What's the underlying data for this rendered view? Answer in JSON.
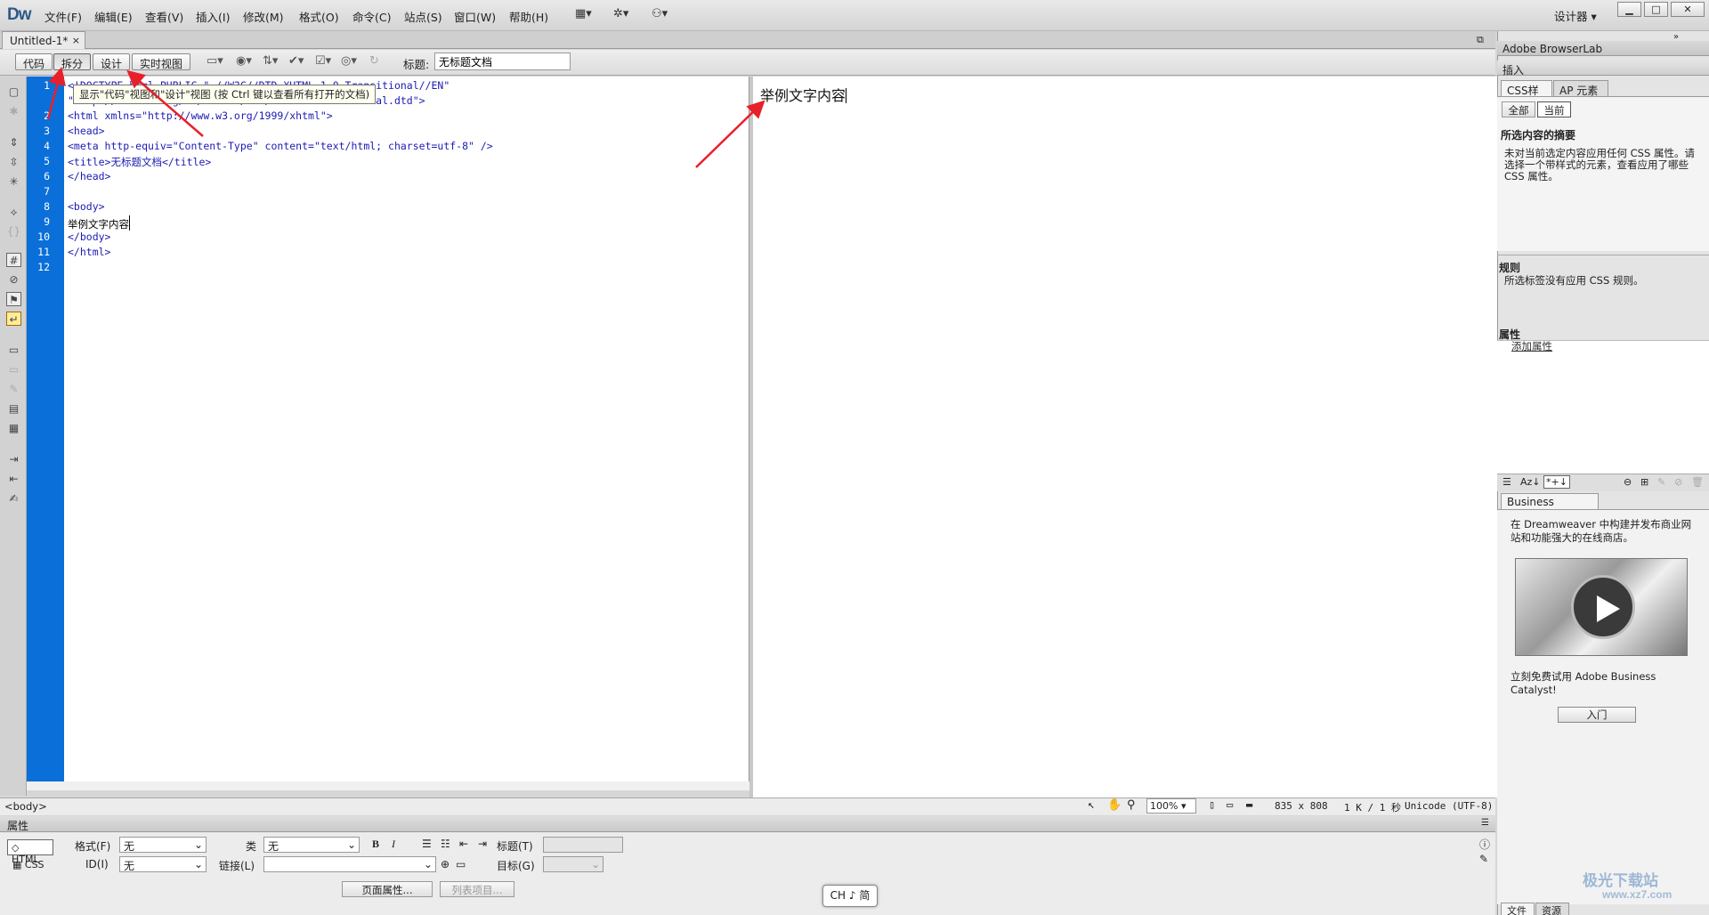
{
  "app": {
    "logo": "Dw"
  },
  "menu": [
    "文件(F)",
    "编辑(E)",
    "查看(V)",
    "插入(I)",
    "修改(M)",
    "格式(O)",
    "命令(C)",
    "站点(S)",
    "窗口(W)",
    "帮助(H)"
  ],
  "workspace": "设计器",
  "tab": {
    "name": "Untitled-1*",
    "close": "×"
  },
  "views": {
    "code": "代码",
    "split": "拆分",
    "design": "设计",
    "live": "实时视图"
  },
  "title_label": "标题:",
  "title_value": "无标题文档",
  "tooltip": "显示\"代码\"视图和\"设计\"视图 (按 Ctrl 键以查看所有打开的文档)",
  "code": {
    "line_numbers": [
      "1",
      "2",
      "3",
      "4",
      "5",
      "6",
      "7",
      "8",
      "9",
      "10",
      "11",
      "12"
    ],
    "lines": [
      "<!DOCTYPE html PUBLIC \"-//W3C//DTD XHTML 1.0 Transitional//EN\"",
      "\"http://www.w3.org/TR/xhtml1/DTD/xhtml1-transitional.dtd\">",
      "<html xmlns=\"http://www.w3.org/1999/xhtml\">",
      "<head>",
      "<meta http-equiv=\"Content-Type\" content=\"text/html; charset=utf-8\" />",
      "<title>无标题文档</title>",
      "</head>",
      "",
      "<body>",
      "举例文字内容",
      "</body>",
      "</html>",
      ""
    ]
  },
  "design_text": "举例文字内容",
  "status": {
    "tag": "<body>",
    "zoom": "100%",
    "size": "835 x 808",
    "download": "1 K / 1 秒",
    "encoding": "Unicode (UTF-8)"
  },
  "properties": {
    "title": "属性",
    "html": "HTML",
    "css": "CSS",
    "format_label": "格式(F)",
    "format_value": "无",
    "id_label": "ID(I)",
    "id_value": "无",
    "class_label": "类",
    "class_value": "无",
    "link_label": "链接(L)",
    "heading_label": "标题(T)",
    "target_label": "目标(G)",
    "bold": "B",
    "italic": "I",
    "page_props": "页面属性...",
    "list_item": "列表项目..."
  },
  "ime": "CH ♪ 简",
  "right": {
    "browserlab": "Adobe BrowserLab",
    "insert": "插入",
    "css_tab": "CSS样式",
    "ap_tab": "AP 元素",
    "all": "全部",
    "current": "当前",
    "summary_title": "所选内容的摘要",
    "summary_text": "未对当前选定内容应用任何 CSS 属性。请选择一个带样式的元素，查看应用了哪些 CSS 属性。",
    "rules_title": "规则",
    "rules_text": "所选标签没有应用 CSS 规则。",
    "attr_title": "属性",
    "add_attr": "添加属性",
    "bc_title": "Business Catalyst",
    "bc_text": "在 Dreamweaver 中构建并发布商业网站和功能强大的在线商店。",
    "bc_text2": "立刻免费试用 Adobe Business Catalyst!",
    "go": "入门",
    "files_tab": "文件",
    "assets_tab": "资源"
  },
  "watermark": {
    "line1": "极光下载站",
    "line2": "www.xz7.com"
  }
}
